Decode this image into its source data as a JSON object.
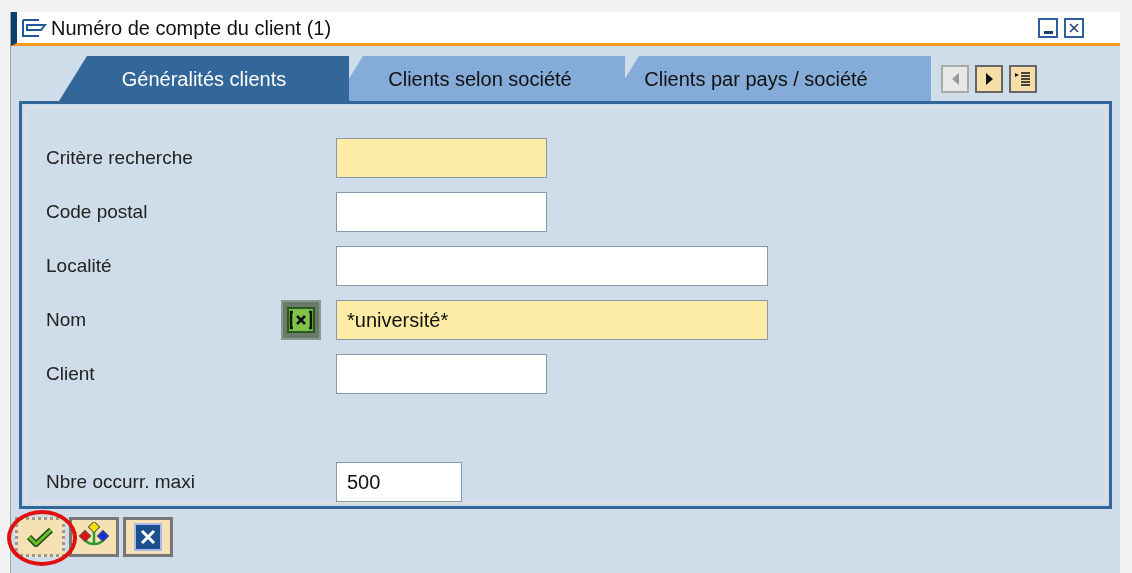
{
  "window": {
    "title": "Numéro de compte du client (1)"
  },
  "tabs": [
    {
      "label": "Généralités clients",
      "selected": true
    },
    {
      "label": "Clients selon société",
      "selected": false
    },
    {
      "label": "Clients par pays / société",
      "selected": false
    }
  ],
  "tab_scroll": {
    "left_disabled": true,
    "right_disabled": false
  },
  "fields": [
    {
      "label": "Critère recherche",
      "required": true,
      "multiselect": false
    },
    {
      "label": "Code postal",
      "required": false,
      "multiselect": false
    },
    {
      "label": "Localité",
      "required": false,
      "multiselect": false
    },
    {
      "label": "Nom",
      "value": "*université*",
      "required": true,
      "multiselect": true
    },
    {
      "label": "Client",
      "required": false,
      "multiselect": false
    },
    {
      "label": "Nbre occurr. maxi",
      "value": "500",
      "required": false,
      "multiselect": false
    }
  ],
  "buttons": [
    {
      "kind": "confirm",
      "highlighted": true
    },
    {
      "kind": "hierarchy",
      "highlighted": false
    },
    {
      "kind": "cancel",
      "highlighted": false
    }
  ]
}
